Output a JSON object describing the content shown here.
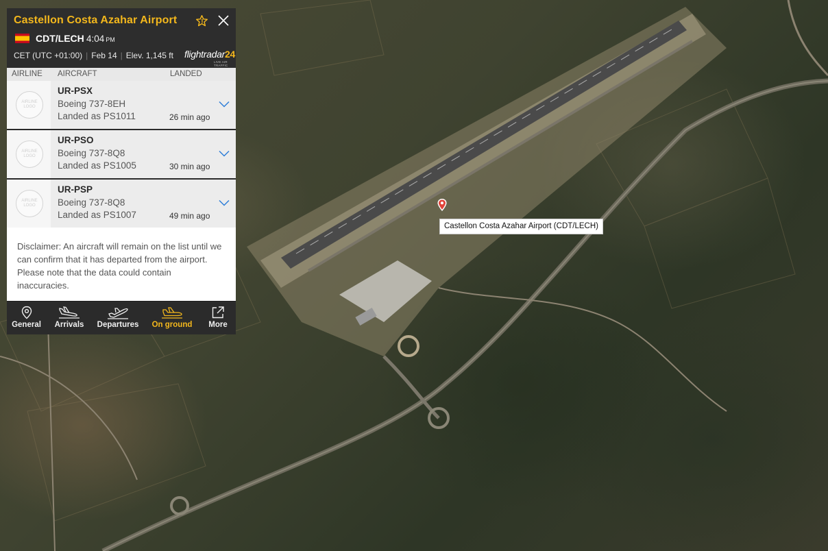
{
  "airport": {
    "name": "Castellon Costa Azahar Airport",
    "codes": "CDT/LECH",
    "local_time": "4:04",
    "local_time_ampm": "PM",
    "timezone": "CET (UTC +01:00)",
    "date": "Feb 14",
    "elevation": "Elev. 1,145 ft"
  },
  "brand": {
    "name": "flightradar",
    "number": "24",
    "tagline": "LIVE AIR TRAFFIC"
  },
  "table": {
    "headers": {
      "airline": "AIRLINE",
      "aircraft": "AIRCRAFT",
      "landed": "LANDED"
    },
    "airline_logo_placeholder": "AIRLINE LOGO",
    "rows": [
      {
        "registration": "UR-PSX",
        "aircraft_type": "Boeing 737-8EH",
        "landed_as": "Landed as PS1011",
        "time_ago": "26 min ago"
      },
      {
        "registration": "UR-PSO",
        "aircraft_type": "Boeing 737-8Q8",
        "landed_as": "Landed as PS1005",
        "time_ago": "30 min ago"
      },
      {
        "registration": "UR-PSP",
        "aircraft_type": "Boeing 737-8Q8",
        "landed_as": "Landed as PS1007",
        "time_ago": "49 min ago"
      }
    ]
  },
  "disclaimer": "Disclaimer: An aircraft will remain on the list until we can confirm that it has departed from the airport. Please note that the data could contain inaccuracies.",
  "nav": {
    "items": [
      {
        "label": "General",
        "icon": "map-pin-icon"
      },
      {
        "label": "Arrivals",
        "icon": "arrival-plane-icon"
      },
      {
        "label": "Departures",
        "icon": "departure-plane-icon"
      },
      {
        "label": "On ground",
        "icon": "on-ground-plane-icon",
        "active": true
      },
      {
        "label": "More",
        "icon": "external-link-icon"
      }
    ]
  },
  "map": {
    "marker_label": "Castellon Costa Azahar Airport (CDT/LECH)"
  },
  "colors": {
    "accent": "#f3b71c",
    "panel_bg": "#2a2a2a",
    "row_bg": "#ececec",
    "marker": "#e0443a"
  }
}
